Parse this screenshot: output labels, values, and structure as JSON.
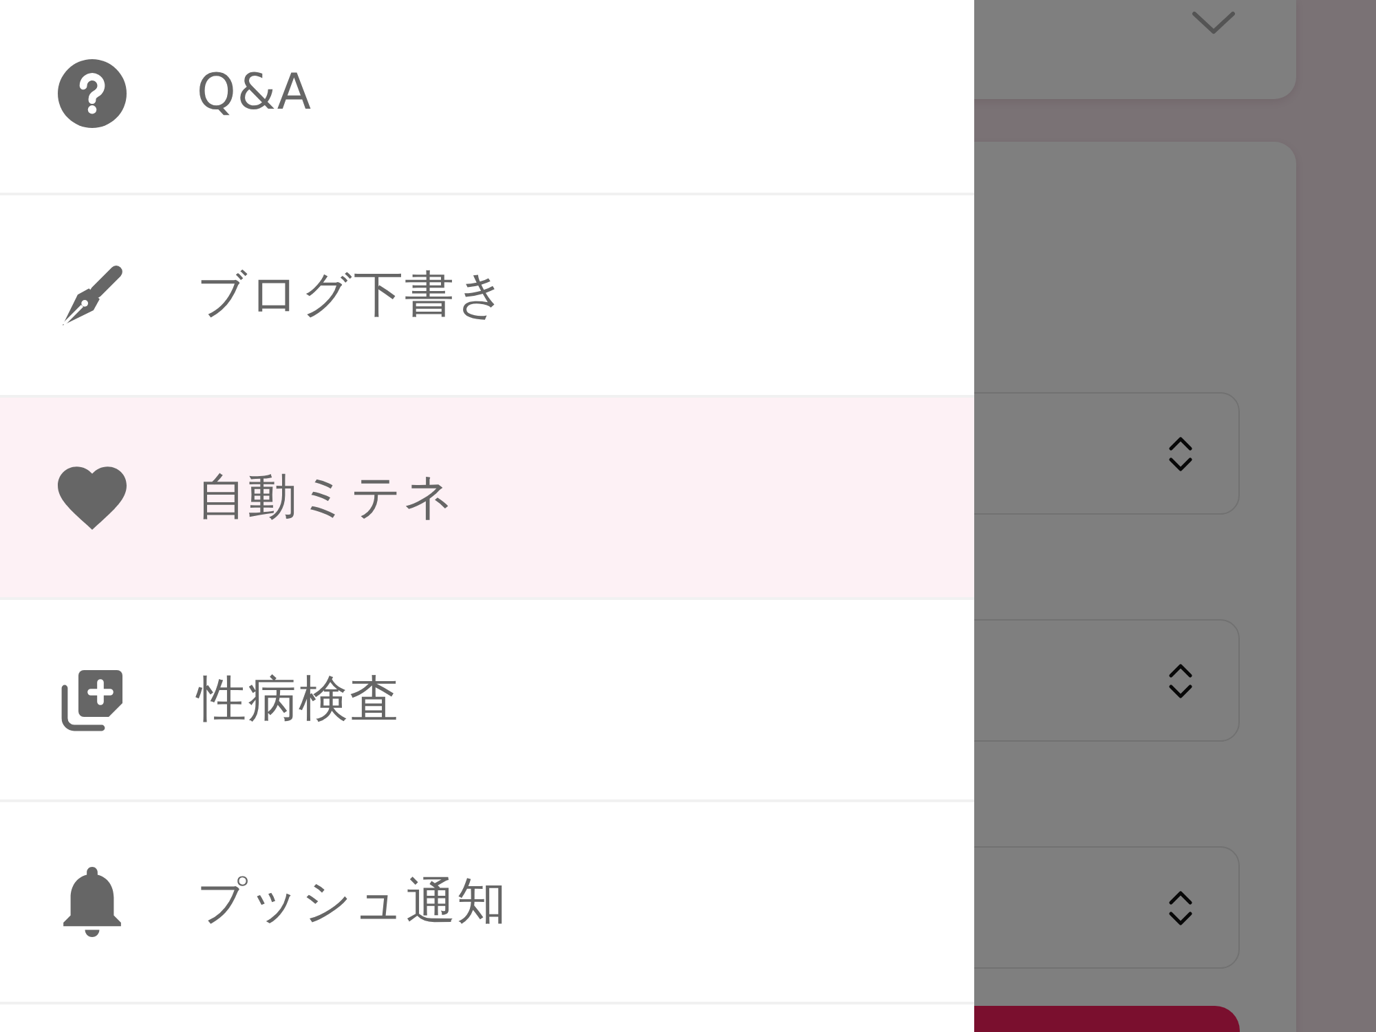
{
  "drawer": {
    "items": [
      {
        "label": "Q&A",
        "selected": false
      },
      {
        "label": "ブログ下書き",
        "selected": false
      },
      {
        "label": "自動ミテネ",
        "selected": true
      },
      {
        "label": "性病検査",
        "selected": false
      },
      {
        "label": "プッシュ通知",
        "selected": false
      }
    ]
  },
  "backdrop": {
    "dimmed": true
  }
}
